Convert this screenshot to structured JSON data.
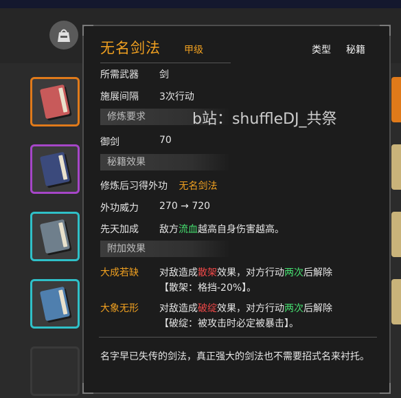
{
  "tooltip": {
    "title": "无名剑法",
    "grade": "甲级",
    "type_label": "类型",
    "type_value": "秘籍",
    "required_weapon_label": "所需武器",
    "required_weapon_value": "剑",
    "cast_interval_label": "施展间隔",
    "cast_interval_value": "3次行动",
    "section_requirements": "修炼要求",
    "req_skill_label": "御剑",
    "req_skill_value": "70",
    "section_manual_effect": "秘籍效果",
    "learn_label": "修炼后习得外功",
    "learn_value": "无名剑法",
    "power_label": "外功威力",
    "power_value": "270 → 720",
    "innate_label": "先天加成",
    "innate_prefix": "敌方",
    "innate_highlight": "流血",
    "innate_suffix": "越高自身伤害越高。",
    "section_extra": "附加效果",
    "extra_1_label": "大成若缺",
    "extra_1_pre": "对敌造成",
    "extra_1_status": "散架",
    "extra_1_mid": "效果，对方行动",
    "extra_1_times": "两次",
    "extra_1_post": "后解除",
    "extra_1_note": "【散架：格挡-20%】。",
    "extra_2_label": "大象无形",
    "extra_2_pre": "对敌造成",
    "extra_2_status": "破绽",
    "extra_2_mid": "效果，对方行动",
    "extra_2_times": "两次",
    "extra_2_post": "后解除",
    "extra_2_note": "【破绽：被攻击时必定被暴击】。",
    "description": "名字早已失传的剑法，真正强大的剑法也不需要招式名来衬托。"
  },
  "watermark": "b站：shuffleDJ_共祭",
  "colors": {
    "gold": "#f0a020",
    "green": "#46e070",
    "red": "#f04848",
    "slot_orange": "#e07a1a",
    "slot_purple": "#a646c8",
    "slot_teal": "#2fc0c8"
  },
  "icons": {
    "bag": "bag-icon",
    "books": [
      "red-book-icon",
      "navy-book-icon",
      "grey-book-icon",
      "blue-book-icon"
    ]
  }
}
